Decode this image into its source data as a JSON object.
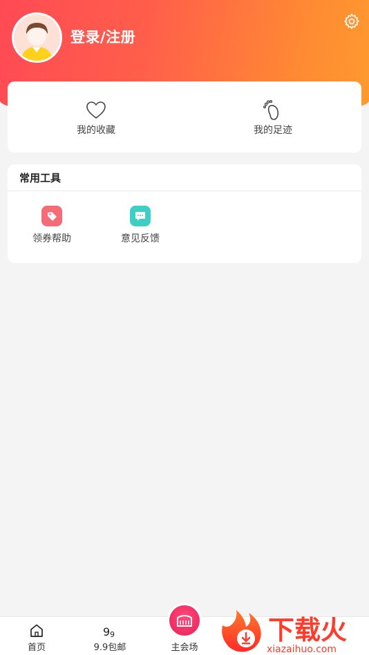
{
  "header": {
    "login_label": "登录/注册",
    "gradient_start": "#ff4a55",
    "gradient_end": "#ff9a2e"
  },
  "favorites": [
    {
      "label": "我的收藏",
      "icon": "heart-icon"
    },
    {
      "label": "我的足迹",
      "icon": "footprint-icon"
    }
  ],
  "tools": {
    "title": "常用工具",
    "items": [
      {
        "label": "领券帮助",
        "icon": "tag-icon",
        "color": "#f56b78"
      },
      {
        "label": "意见反馈",
        "icon": "chat-icon",
        "color": "#3dcfc3"
      }
    ]
  },
  "tabbar": {
    "tabs": [
      {
        "label": "首页",
        "icon": "home-icon"
      },
      {
        "label": "9.9包邮",
        "icon": "nine-nine-icon"
      },
      {
        "label": "主会场",
        "icon": "main-venue-icon"
      }
    ]
  },
  "watermark": {
    "title": "下载火",
    "site": "xiazaihuo.com"
  }
}
